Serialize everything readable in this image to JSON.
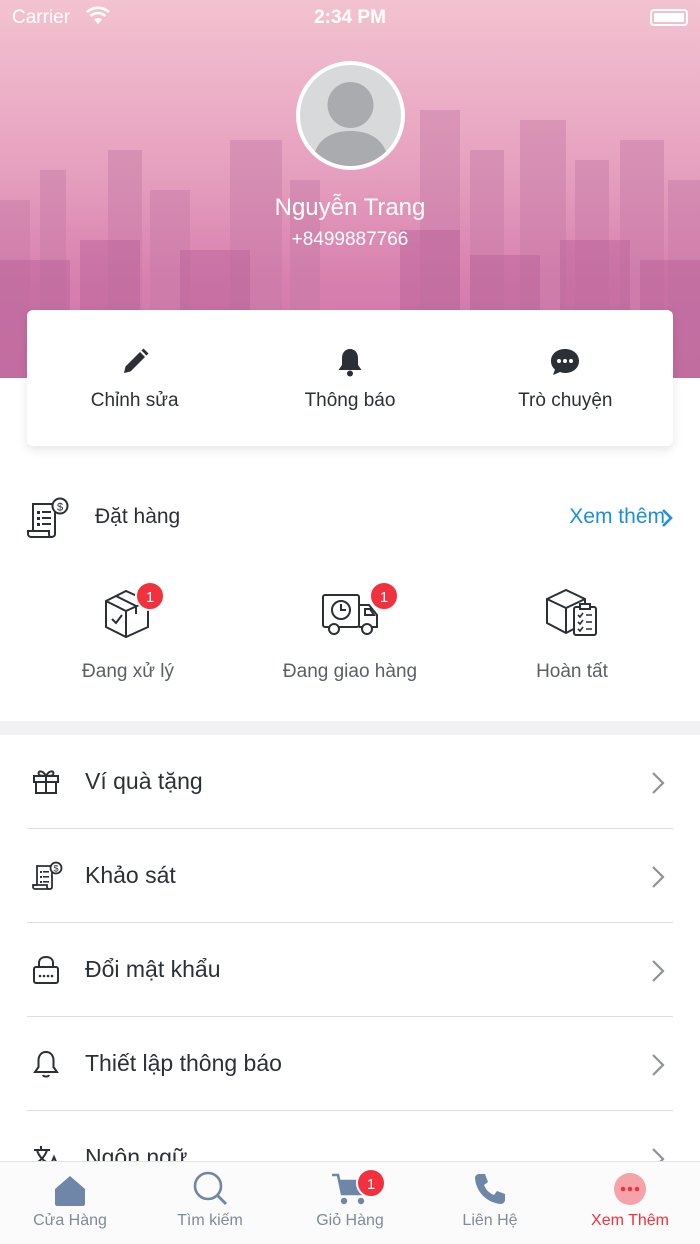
{
  "status_bar": {
    "carrier": "Carrier",
    "time": "2:34 PM"
  },
  "profile": {
    "name": "Nguyễn Trang",
    "phone": "+8499887766"
  },
  "actions": [
    {
      "label": "Chỉnh sửa",
      "icon": "pencil-icon"
    },
    {
      "label": "Thông báo",
      "icon": "bell-icon"
    },
    {
      "label": "Trò chuyện",
      "icon": "chat-bubble-icon"
    }
  ],
  "orders": {
    "title": "Đặt hàng",
    "more_label": "Xem thêm",
    "statuses": [
      {
        "label": "Đang xử lý",
        "badge": "1",
        "icon": "box-icon"
      },
      {
        "label": "Đang giao hàng",
        "badge": "1",
        "icon": "delivery-truck-icon"
      },
      {
        "label": "Hoàn tất",
        "icon": "box-checklist-icon"
      }
    ]
  },
  "menu": [
    {
      "label": "Ví quà tặng",
      "icon": "gift-icon"
    },
    {
      "label": "Khảo sát",
      "icon": "survey-icon"
    },
    {
      "label": "Đổi mật khẩu",
      "icon": "lock-icon"
    },
    {
      "label": "Thiết lập thông báo",
      "icon": "bell-outline-icon"
    },
    {
      "label": "Ngôn ngữ",
      "icon": "translate-icon"
    }
  ],
  "tabbar": {
    "tabs": [
      {
        "label": "Cửa Hàng",
        "icon": "home-icon"
      },
      {
        "label": "Tìm kiếm",
        "icon": "search-icon"
      },
      {
        "label": "Giỏ Hàng",
        "icon": "cart-icon",
        "badge": "1"
      },
      {
        "label": "Liên Hệ",
        "icon": "phone-icon"
      },
      {
        "label": "Xem Thêm",
        "icon": "more-icon",
        "active": true
      }
    ]
  },
  "colors": {
    "accent": "#f2313e",
    "link": "#1d8fd8",
    "hero_top": "#f3c3d1",
    "hero_bottom": "#cd78a9"
  }
}
